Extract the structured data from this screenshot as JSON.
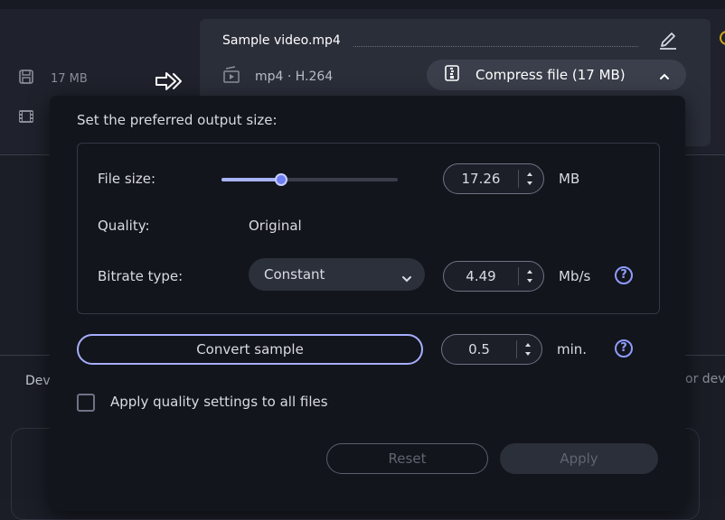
{
  "background": {
    "left_file_size": "17 MB",
    "tab_left_partial": "Dev",
    "tab_right_partial": "or devi"
  },
  "file_card": {
    "file_name": "Sample video.mp4",
    "codec": "mp4 · H.264",
    "compress_label": "Compress file (17 MB)"
  },
  "compress_panel": {
    "title": "Set the preferred output size:",
    "file_size_label": "File size:",
    "file_size_value": "17.26",
    "file_size_unit": "MB",
    "file_size_slider_fraction": 0.34,
    "quality_label": "Quality:",
    "quality_value": "Original",
    "bitrate_type_label": "Bitrate type:",
    "bitrate_type_value": "Constant",
    "bitrate_value": "4.49",
    "bitrate_unit": "Mb/s",
    "convert_sample_label": "Convert sample",
    "sample_length_value": "0.5",
    "sample_length_unit": "min.",
    "apply_all_label": "Apply quality settings to all files",
    "apply_all_checked": false,
    "reset_label": "Reset",
    "apply_label": "Apply"
  },
  "icons": [
    "save-icon",
    "film-strip-icon",
    "convert-arrow-icon",
    "video-file-icon",
    "pencil-icon",
    "compress-icon",
    "chevron-up-icon",
    "chevron-down-icon",
    "help-icon"
  ],
  "colors": {
    "accent": "#8e9cff",
    "slider_fill": "#a8b3f5",
    "panel_bg": "#13151c",
    "card_bg": "#2a2e39"
  }
}
